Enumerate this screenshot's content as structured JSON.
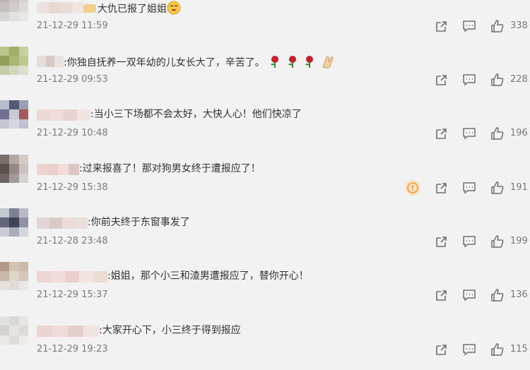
{
  "colors": {
    "background": "#f2f2f2",
    "text": "#333333",
    "meta": "#7a7a7a",
    "icon": "#6f6f6f",
    "report_accent": "#f39a2b"
  },
  "action_icons": [
    "share-icon",
    "reply-icon",
    "like-icon"
  ],
  "comments": [
    {
      "text": "大仇已报了姐姐",
      "timestamp": "21-12-29 11:59",
      "likes": "338",
      "trailing_icon": "laughing-face-emoji"
    },
    {
      "text": ":你独自抚养一双年幼的儿女长大了，辛苦了。",
      "timestamp": "21-12-29 09:53",
      "likes": "228",
      "trailing_icon": "rose-emoji x3, clap-emoji"
    },
    {
      "text": ":当小三下场都不会太好，大快人心！他们快凉了",
      "timestamp": "21-12-29 10:48",
      "likes": "196"
    },
    {
      "text": ":过来报喜了！那对狗男女终于遭报应了！",
      "timestamp": "21-12-29 15:38",
      "likes": "191",
      "has_report_icon": true
    },
    {
      "text": ":你前夫终于东窗事发了",
      "timestamp": "21-12-28 23:48",
      "likes": "199"
    },
    {
      "text": ":姐姐，那个小三和渣男遭报应了，替你开心！",
      "timestamp": "21-12-29 15:37",
      "likes": "136"
    },
    {
      "text": ":大家开心下，小三终于得到报应",
      "timestamp": "21-12-29 19:23",
      "likes": "115"
    }
  ]
}
